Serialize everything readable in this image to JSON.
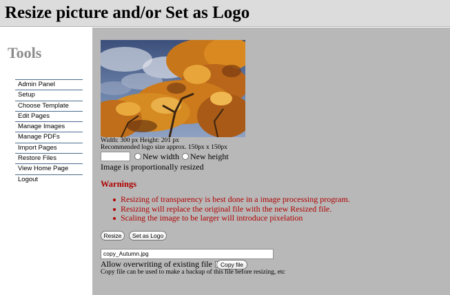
{
  "header": {
    "title": "Resize picture and/or Set as Logo"
  },
  "sidebar": {
    "title": "Tools",
    "items": [
      {
        "label": "Admin Panel"
      },
      {
        "label": "Setup"
      },
      {
        "label": "Choose Template"
      },
      {
        "label": "Edit Pages"
      },
      {
        "label": "Manage Images"
      },
      {
        "label": "Manage PDFs"
      },
      {
        "label": "Import Pages"
      },
      {
        "label": "Restore Files"
      },
      {
        "label": "View Home Page"
      },
      {
        "label": "Logout"
      }
    ]
  },
  "main": {
    "image_info": {
      "dimensions": "Width: 300 px Height: 201 px",
      "recommendation": "Recommended logo size approx. 150px x 150px"
    },
    "resize": {
      "size_value": "",
      "new_width_label": "New width",
      "new_height_label": "New height",
      "proportional_note": "Image is proportionally resized"
    },
    "warnings": {
      "title": "Warnings",
      "items": [
        "Resizing of transparency is best done in a image processing program.",
        "Resizing will replace the original file with the new Resized file.",
        "Scaling the image to be larger will introduce pixelation"
      ]
    },
    "buttons": {
      "resize": "Resize",
      "set_logo": "Set as Logo",
      "copy_file": "Copy file"
    },
    "copy": {
      "filename": "copy_Autumn.jpg",
      "overwrite_label": "Allow overwriting of existing file",
      "note": "Copy file can be used to make a backup of this file before resizing, etc"
    }
  },
  "colors": {
    "header_bg": "#dcdcdc",
    "main_bg": "#b8b8b8",
    "warning_red": "#b00000",
    "sidebar_title": "#8c8c8c",
    "nav_border": "#4a6a8c"
  }
}
